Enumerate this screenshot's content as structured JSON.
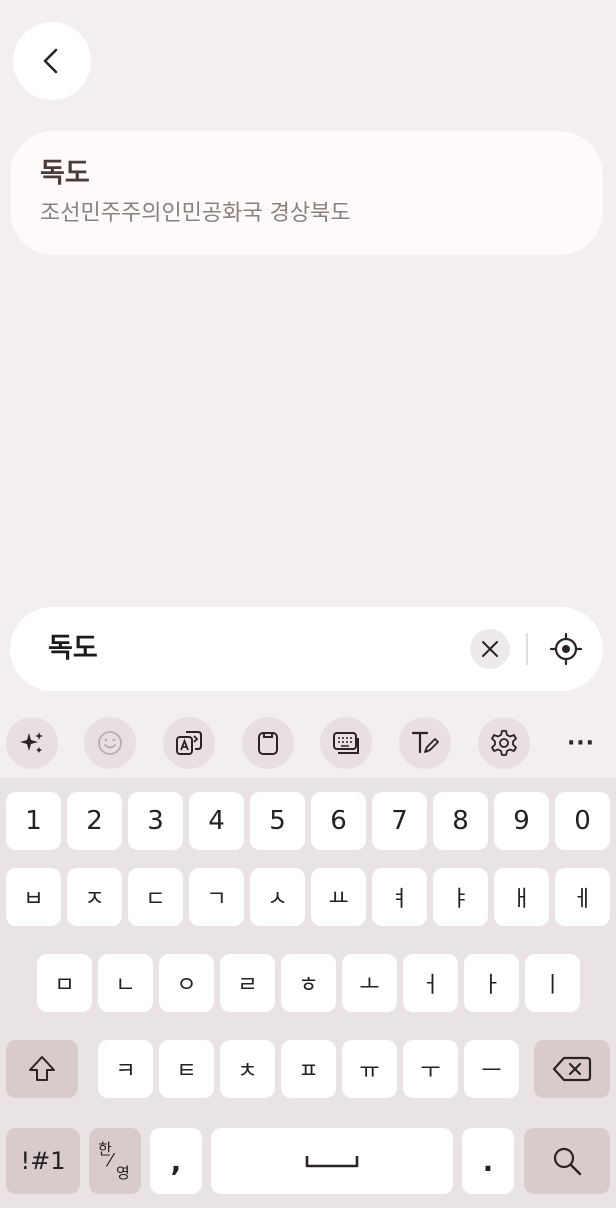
{
  "header": {
    "back_icon": "chevron-left-icon"
  },
  "result": {
    "title": "독도",
    "subtitle": "조선민주주의인민공화국 경상북도"
  },
  "search": {
    "query": "독도",
    "clear_icon": "close-icon",
    "locate_icon": "target-icon"
  },
  "toolbar": {
    "items": [
      "sparkle-icon",
      "emoji-icon",
      "translate-icon",
      "clipboard-icon",
      "keyboard-mode-icon",
      "handwriting-icon",
      "settings-icon",
      "more-icon"
    ],
    "more_label": "···"
  },
  "keyboard": {
    "numbers": [
      "1",
      "2",
      "3",
      "4",
      "5",
      "6",
      "7",
      "8",
      "9",
      "0"
    ],
    "row1": [
      "ㅂ",
      "ㅈ",
      "ㄷ",
      "ㄱ",
      "ㅅ",
      "ㅛ",
      "ㅕ",
      "ㅑ",
      "ㅐ",
      "ㅔ"
    ],
    "row2": [
      "ㅁ",
      "ㄴ",
      "ㅇ",
      "ㄹ",
      "ㅎ",
      "ㅗ",
      "ㅓ",
      "ㅏ",
      "ㅣ"
    ],
    "row3": [
      "ㅋ",
      "ㅌ",
      "ㅊ",
      "ㅍ",
      "ㅠ",
      "ㅜ",
      "ㅡ"
    ],
    "symbols_label": "!#1",
    "lang_top": "한",
    "lang_bottom": "영",
    "comma": ",",
    "period": "."
  }
}
